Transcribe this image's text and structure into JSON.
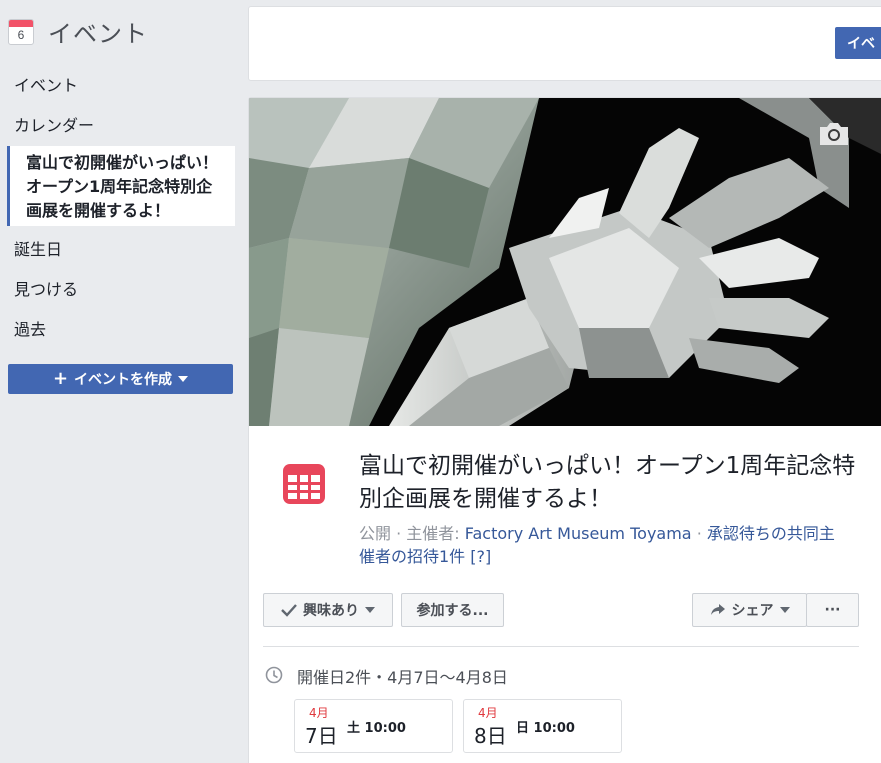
{
  "sidebar": {
    "calendar_day": "6",
    "title": "イベント",
    "items": [
      "イベント",
      "カレンダー"
    ],
    "selected_event": "富山で初開催がいっぱい！オープン1周年記念特別企画展を開催するよ！",
    "items_after": [
      "誕生日",
      "見つける",
      "過去"
    ],
    "create_button": "イベントを作成",
    "create_plus": "+"
  },
  "top_card": {
    "button_label": "イベ"
  },
  "event": {
    "title": "富山で初開催がいっぱい！オープン1周年記念特別企画展を開催するよ！",
    "visibility": "公開 · 主催者: ",
    "host": "Factory Art Museum Toyama",
    "separator": " · ",
    "cohost_invites": "承認待ちの共同主催者の招待1件",
    "help": "[?]",
    "colors": {
      "accent": "#4267b2",
      "event_icon": "#e8465b",
      "date_red": "#e0393e"
    }
  },
  "actions": {
    "interested": "興味あり",
    "going": "参加する...",
    "share": "シェア",
    "more": "···"
  },
  "schedule": {
    "summary": "開催日2件・4月7日〜4月8日",
    "dates": [
      {
        "month": "4月",
        "day": "7日",
        "weekday": "土",
        "time": "10:00"
      },
      {
        "month": "4月",
        "day": "8日",
        "weekday": "日",
        "time": "10:00"
      }
    ]
  }
}
